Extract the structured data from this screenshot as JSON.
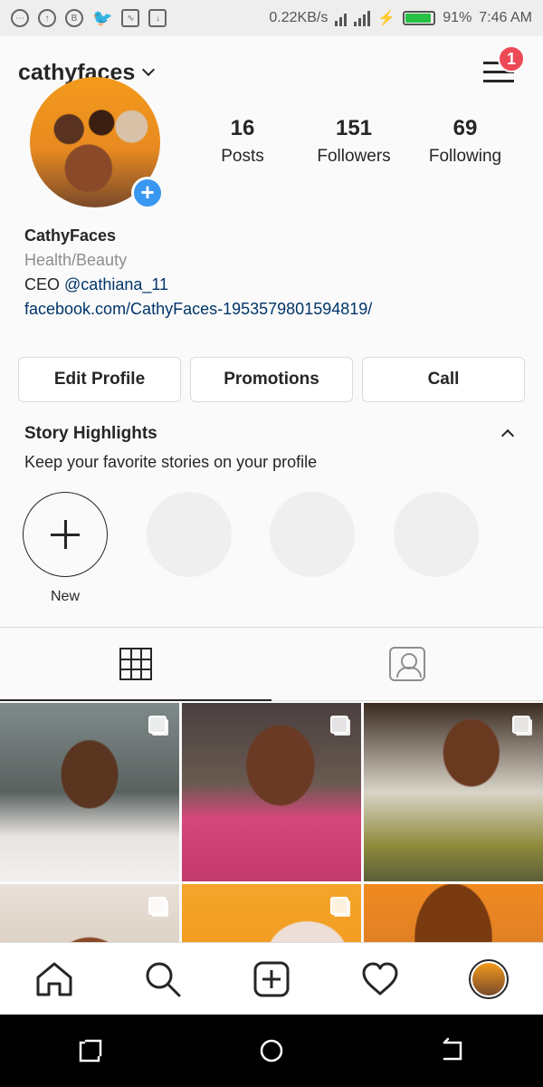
{
  "status_bar": {
    "speed": "0.22KB/s",
    "battery": "91%",
    "battery_level": 0.91,
    "time": "7:46 AM"
  },
  "header": {
    "username": "cathyfaces",
    "notification_count": "1"
  },
  "stats": [
    {
      "value": "16",
      "label": "Posts"
    },
    {
      "value": "151",
      "label": "Followers"
    },
    {
      "value": "69",
      "label": "Following"
    }
  ],
  "bio": {
    "name": "CathyFaces",
    "category": "Health/Beauty",
    "role": "CEO",
    "mention": "@cathiana_11",
    "link": "facebook.com/CathyFaces-1953579801594819/"
  },
  "buttons": {
    "edit_profile": "Edit Profile",
    "promotions": "Promotions",
    "call": "Call"
  },
  "highlights": {
    "title": "Story Highlights",
    "subtitle": "Keep your favorite stories on your profile",
    "new_label": "New"
  },
  "colors": {
    "accent_blue": "#3897f0",
    "badge_red": "#ed4956",
    "link_blue": "#003569"
  }
}
